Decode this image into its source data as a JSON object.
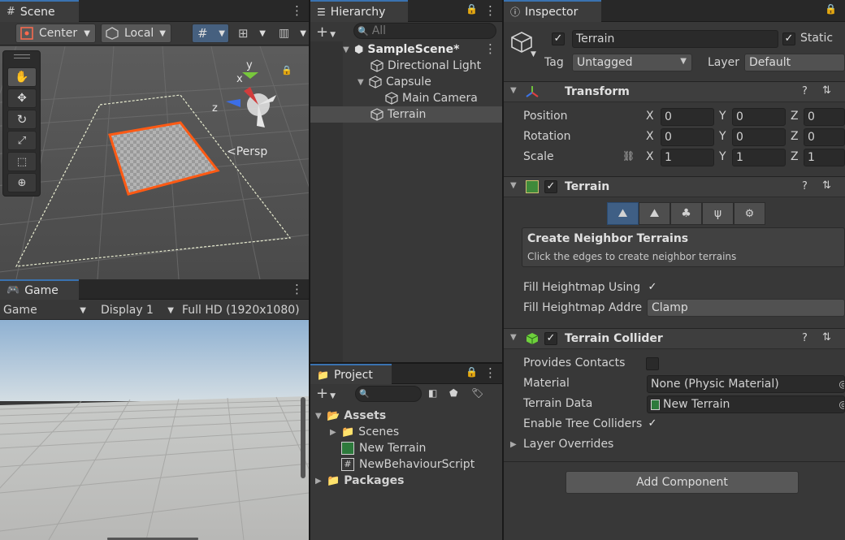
{
  "scene": {
    "tab": "Scene",
    "pivot": "Center",
    "space": "Local",
    "persp_label": "Persp",
    "axis_x": "x",
    "axis_y": "y",
    "axis_z": "z"
  },
  "game": {
    "tab": "Game",
    "mode": "Game",
    "display": "Display 1",
    "resolution": "Full HD (1920x1080)"
  },
  "hierarchy": {
    "tab": "Hierarchy",
    "search_placeholder": "All",
    "items": [
      {
        "label": "SampleScene*"
      },
      {
        "label": "Directional Light"
      },
      {
        "label": "Capsule"
      },
      {
        "label": "Main Camera"
      },
      {
        "label": "Terrain"
      }
    ]
  },
  "project": {
    "tab": "Project",
    "assets": "Assets",
    "scenes": "Scenes",
    "new_terrain": "New Terrain",
    "script": "NewBehaviourScript",
    "packages": "Packages"
  },
  "inspector": {
    "tab": "Inspector",
    "object_name": "Terrain",
    "static_label": "Static",
    "tag_label": "Tag",
    "tag_value": "Untagged",
    "layer_label": "Layer",
    "layer_value": "Default",
    "transform": {
      "title": "Transform",
      "position_label": "Position",
      "rotation_label": "Rotation",
      "scale_label": "Scale",
      "x": "X",
      "y": "Y",
      "z": "Z",
      "position": [
        "0",
        "0",
        "0"
      ],
      "rotation": [
        "0",
        "0",
        "0"
      ],
      "scale": [
        "1",
        "1",
        "1"
      ]
    },
    "terrain": {
      "title": "Terrain",
      "neighbor_title": "Create Neighbor Terrains",
      "neighbor_desc": "Click the edges to create neighbor terrains",
      "fill_heightmap_label": "Fill Heightmap Using",
      "fill_address_label": "Fill Heightmap Addre",
      "fill_address_value": "Clamp"
    },
    "collider": {
      "title": "Terrain Collider",
      "provides_contacts_label": "Provides Contacts",
      "material_label": "Material",
      "material_value": "None (Physic Material)",
      "terrain_data_label": "Terrain Data",
      "terrain_data_value": "New Terrain",
      "enable_tree_label": "Enable Tree Colliders",
      "layer_overrides_label": "Layer Overrides"
    },
    "add_component": "Add Component"
  }
}
